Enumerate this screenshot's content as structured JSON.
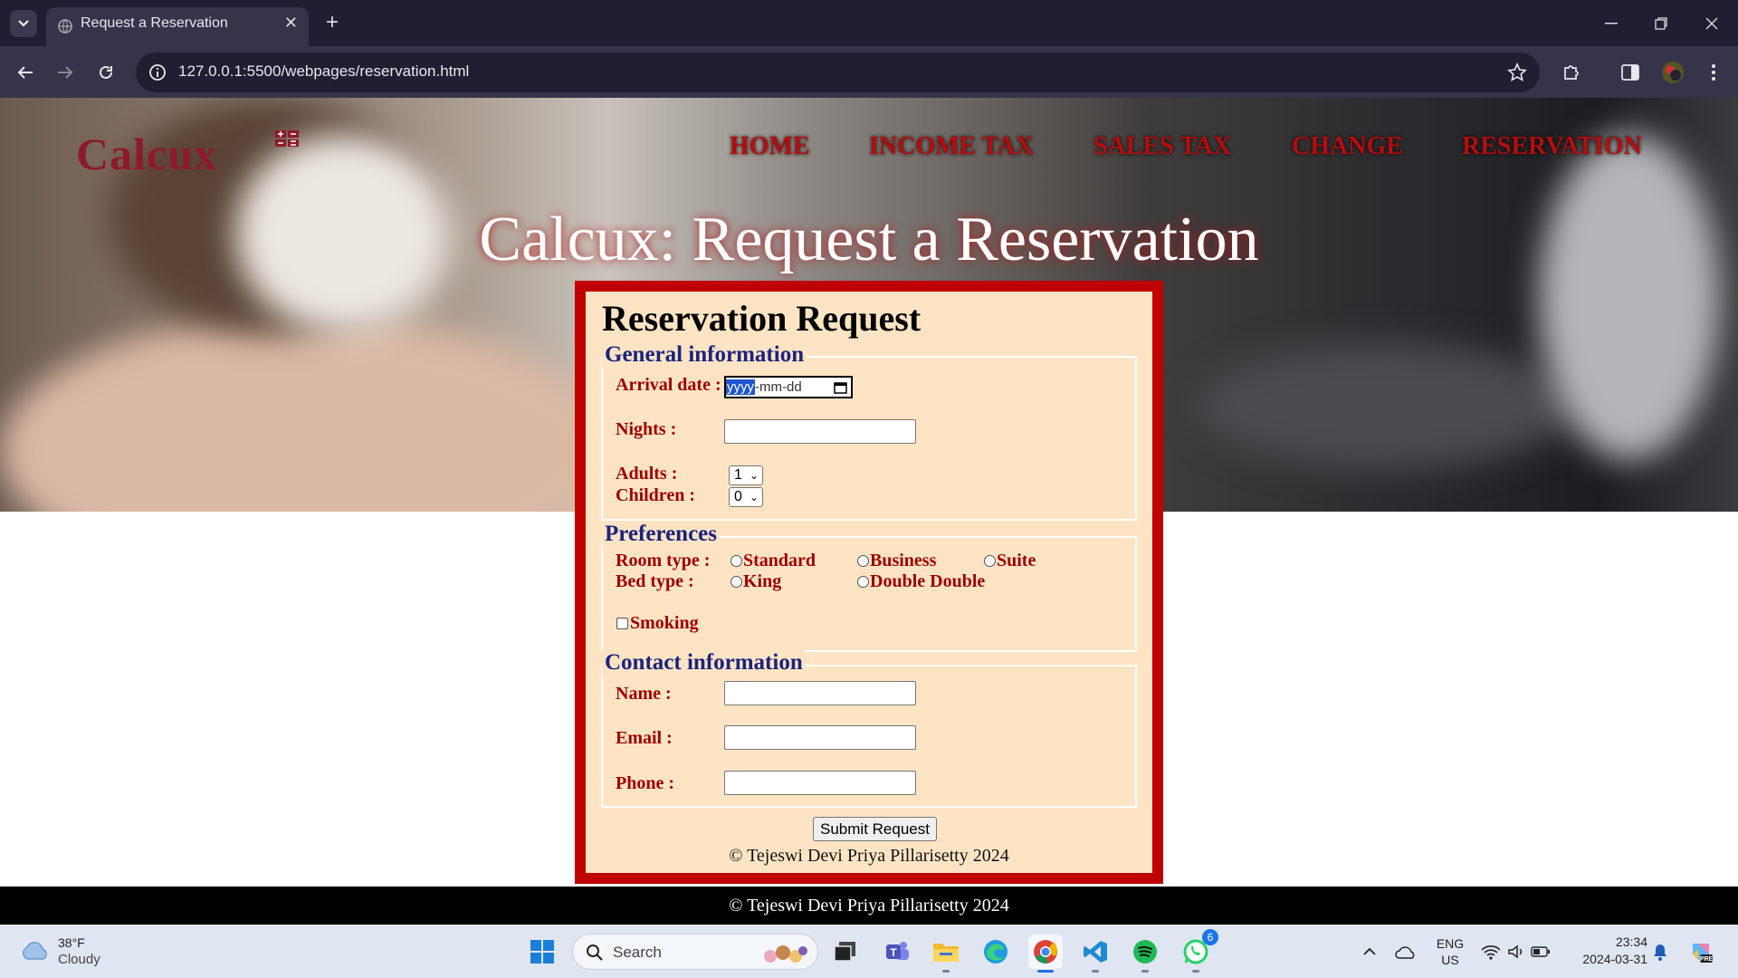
{
  "browser": {
    "tab_title": "Request a Reservation",
    "url": "127.0.0.1:5500/webpages/reservation.html",
    "tab_close": "✕",
    "new_tab": "+"
  },
  "site": {
    "logo": "Calcux",
    "nav": [
      "HOME",
      "INCOME TAX",
      "SALES TAX",
      "CHANGE",
      "RESERVATION"
    ],
    "hero_title": "Calcux: Request a Reservation"
  },
  "form": {
    "heading": "Reservation Request",
    "general": {
      "legend": "General information",
      "arrival_label": "Arrival date :",
      "date_placeholder_year": "yyyy",
      "date_placeholder_rest": "-mm-dd",
      "nights_label": "Nights :",
      "nights_value": "",
      "adults_label": "Adults :",
      "adults_value": "1",
      "children_label": "Children :",
      "children_value": "0"
    },
    "preferences": {
      "legend": "Preferences",
      "room_label": "Room type :",
      "room_options": [
        "Standard",
        "Business",
        "Suite"
      ],
      "bed_label": "Bed type :",
      "bed_options": [
        "King",
        "Double Double"
      ],
      "smoking_label": "Smoking"
    },
    "contact": {
      "legend": "Contact information",
      "name_label": "Name :",
      "email_label": "Email :",
      "phone_label": "Phone :",
      "name_value": "",
      "email_value": "",
      "phone_value": ""
    },
    "submit_label": "Submit Request",
    "copyright": "© Tejeswi Devi Priya Pillarisetty 2024"
  },
  "footer": {
    "text": "©   Tejeswi Devi Priya Pillarisetty 2024"
  },
  "taskbar": {
    "weather_temp": "38°F",
    "weather_desc": "Cloudy",
    "search_placeholder": "Search",
    "lang_top": "ENG",
    "lang_bottom": "US",
    "time": "23:34",
    "date": "2024-03-31",
    "whatsapp_badge": "6"
  },
  "colors": {
    "brand_red": "#c00000",
    "form_bg": "#ffe4c4",
    "legend_blue": "#1a237e",
    "label_red": "#a00000"
  }
}
